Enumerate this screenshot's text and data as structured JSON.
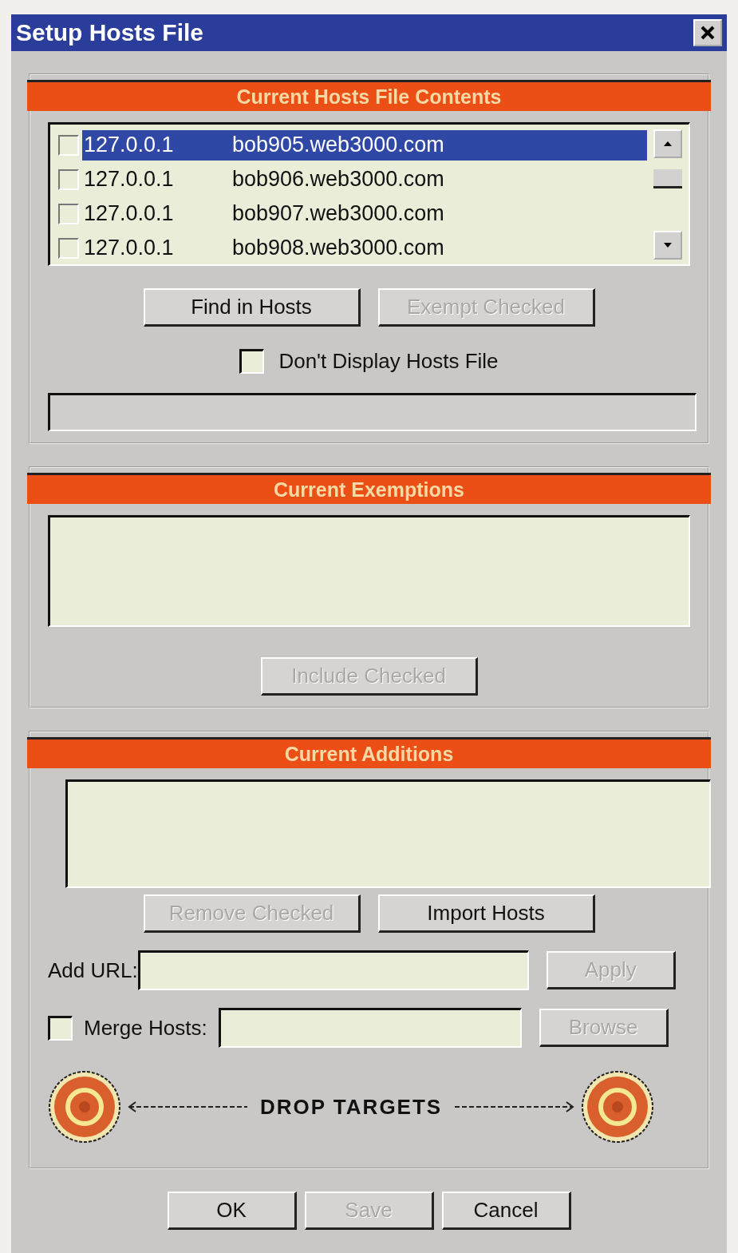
{
  "window": {
    "title": "Setup Hosts File"
  },
  "hosts_section": {
    "title": "Current Hosts File Contents",
    "rows": [
      {
        "ip": "127.0.0.1",
        "host": "bob905.web3000.com",
        "checked": false,
        "selected": true
      },
      {
        "ip": "127.0.0.1",
        "host": "bob906.web3000.com",
        "checked": false,
        "selected": false
      },
      {
        "ip": "127.0.0.1",
        "host": "bob907.web3000.com",
        "checked": false,
        "selected": false
      },
      {
        "ip": "127.0.0.1",
        "host": "bob908.web3000.com",
        "checked": false,
        "selected": false
      }
    ],
    "buttons": [
      {
        "label": "Find in Hosts",
        "disabled": false
      },
      {
        "label": "Exempt Checked",
        "disabled": true
      }
    ],
    "dont_display": {
      "label": "Don't Display Hosts File",
      "checked": false
    }
  },
  "exemptions_section": {
    "title": "Current Exemptions",
    "button": {
      "label": "Include Checked",
      "disabled": true
    }
  },
  "additions_section": {
    "title": "Current Additions",
    "buttons": [
      {
        "label": "Remove Checked",
        "disabled": true
      },
      {
        "label": "Import Hosts",
        "disabled": false
      }
    ],
    "add_url": {
      "label": "Add URL:"
    },
    "apply": {
      "label": "Apply",
      "disabled": true
    },
    "merge": {
      "label": "Merge Hosts:",
      "checked": false
    },
    "browse": {
      "label": "Browse",
      "disabled": true
    },
    "drop_label": "DROP TARGETS"
  },
  "footer_buttons": [
    {
      "label": "OK",
      "disabled": false
    },
    {
      "label": "Save",
      "disabled": true
    },
    {
      "label": "Cancel",
      "disabled": false
    }
  ]
}
